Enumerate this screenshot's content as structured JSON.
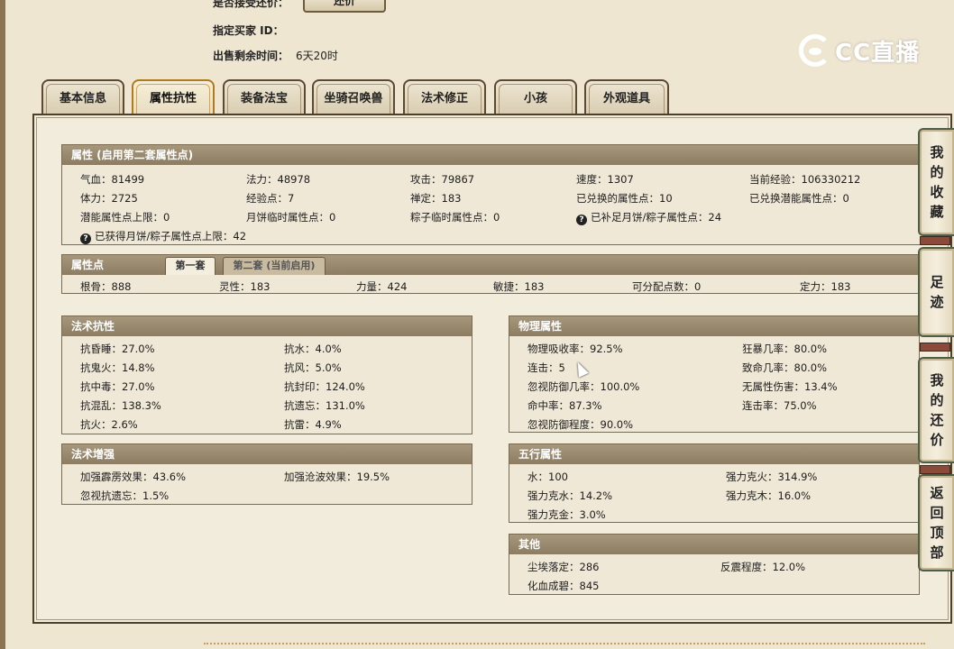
{
  "header": {
    "accept_counter_label": "是否接受还价：",
    "counter_button": "还价",
    "buyer_id_label": "指定买家 ID：",
    "time_left_label": "出售剩余时间：",
    "time_left_value": "6天20时",
    "logo_text": "CC直播"
  },
  "tabs": [
    {
      "label": "基本信息"
    },
    {
      "label": "属性抗性"
    },
    {
      "label": "装备法宝"
    },
    {
      "label": "坐骑召唤兽"
    },
    {
      "label": "法术修正"
    },
    {
      "label": "小孩"
    },
    {
      "label": "外观道具"
    }
  ],
  "attr": {
    "title": "属性 (启用第二套属性点)",
    "rows": [
      [
        "气血：81499",
        "法力：48978",
        "攻击：79867",
        "速度：1307",
        "当前经验：106330212"
      ],
      [
        "体力：2725",
        "经验点：7",
        "禅定：183",
        "已兑换的属性点：10",
        "已兑换潜能属性点：0"
      ],
      [
        "潜能属性点上限：0",
        "月饼临时属性点：0",
        "粽子临时属性点：0",
        "已补足月饼/粽子属性点：24"
      ],
      [
        "已获得月饼/粽子属性点上限：42"
      ]
    ]
  },
  "points": {
    "title": "属性点",
    "tab1": "第一套",
    "tab2": "第二套 (当前启用)",
    "values": [
      "根骨：888",
      "灵性：183",
      "力量：424",
      "敏捷：183",
      "可分配点数：0",
      "定力：183"
    ]
  },
  "magic_resist": {
    "title": "法术抗性",
    "items": [
      "抗昏睡：27.0%",
      "抗水：4.0%",
      "抗鬼火：14.8%",
      "抗风：5.0%",
      "抗中毒：27.0%",
      "抗封印：124.0%",
      "抗混乱：138.3%",
      "抗遗忘：131.0%",
      "抗火：2.6%",
      "抗雷：4.9%"
    ]
  },
  "magic_boost": {
    "title": "法术增强",
    "items": [
      "加强霹雳效果：43.6%",
      "加强沧波效果：19.5%",
      "忽视抗遗忘：1.5%"
    ]
  },
  "physical": {
    "title": "物理属性",
    "items": [
      "物理吸收率：92.5%",
      "狂暴几率：80.0%",
      "连击：5",
      "致命几率：80.0%",
      "忽视防御几率：100.0%",
      "无属性伤害：13.4%",
      "命中率：87.3%",
      "连击率：75.0%",
      "忽视防御程度：90.0%"
    ]
  },
  "five_elements": {
    "title": "五行属性",
    "items": [
      "水：100",
      "强力克火：314.9%",
      "强力克水：14.2%",
      "强力克木：16.0%",
      "强力克金：3.0%"
    ]
  },
  "other": {
    "title": "其他",
    "items": [
      "尘埃落定：286",
      "反震程度：12.0%",
      "化血成碧：845"
    ]
  },
  "side": {
    "favorites": "我的收藏",
    "footprints": "足迹",
    "my_offers": "我的还价",
    "back_top": "返回顶部"
  }
}
